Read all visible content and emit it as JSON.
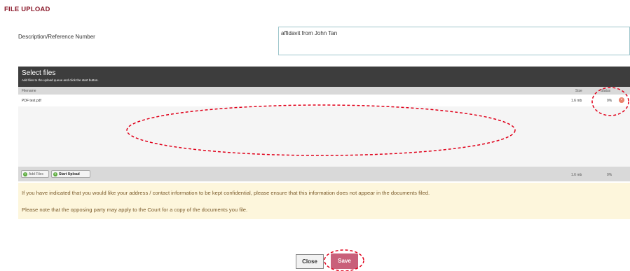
{
  "page": {
    "title": "FILE UPLOAD"
  },
  "form": {
    "description_label": "Description/Reference Number",
    "description_value": "affidavit from John Tan"
  },
  "uploader": {
    "title": "Select files",
    "subtitle": "Add files to the upload queue and click the start button.",
    "columns": {
      "filename": "Filename",
      "size": "Size",
      "status": "Status"
    },
    "files": [
      {
        "name": "PDF test.pdf",
        "size": "1.6 mb",
        "status": "0%"
      }
    ],
    "add_files_label": "Add Files",
    "start_upload_label": "Start Upload",
    "total_size": "1.6 mb",
    "total_status": "0%",
    "icons": {
      "remove": "remove-icon",
      "add": "plus-circle-icon",
      "start": "plus-circle-icon"
    }
  },
  "notice": {
    "line1": "If you have indicated that you would like your address / contact information to be kept confidential, please ensure that this information does not appear in the documents filed.",
    "line2": "Please note that the opposing party may apply to the Court for a copy of the documents you file."
  },
  "actions": {
    "close_label": "Close",
    "save_label": "Save"
  },
  "colors": {
    "title": "#8b1a2b",
    "header": "#3d3d3d",
    "save": "#c9607a",
    "notice_bg": "#fdf6dc",
    "annotation": "#e0001a"
  }
}
